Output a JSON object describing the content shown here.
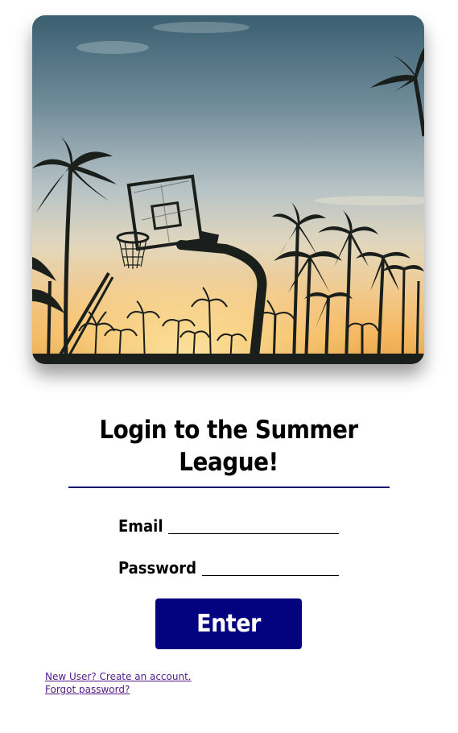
{
  "hero": {
    "image_description_icon": "basketball-hoop-palm-trees-sunset-image"
  },
  "login": {
    "title_line1": "Login to the Summer",
    "title_line2": "League!",
    "email_label": "Email",
    "email_value": "",
    "password_label": "Password",
    "password_value": "",
    "enter_label": "Enter"
  },
  "links": {
    "create_account": "New User? Create an account.",
    "forgot_password": "Forgot password?"
  },
  "colors": {
    "button_bg": "#03037f",
    "rule": "#0b0b6e",
    "link": "#551a8b"
  }
}
